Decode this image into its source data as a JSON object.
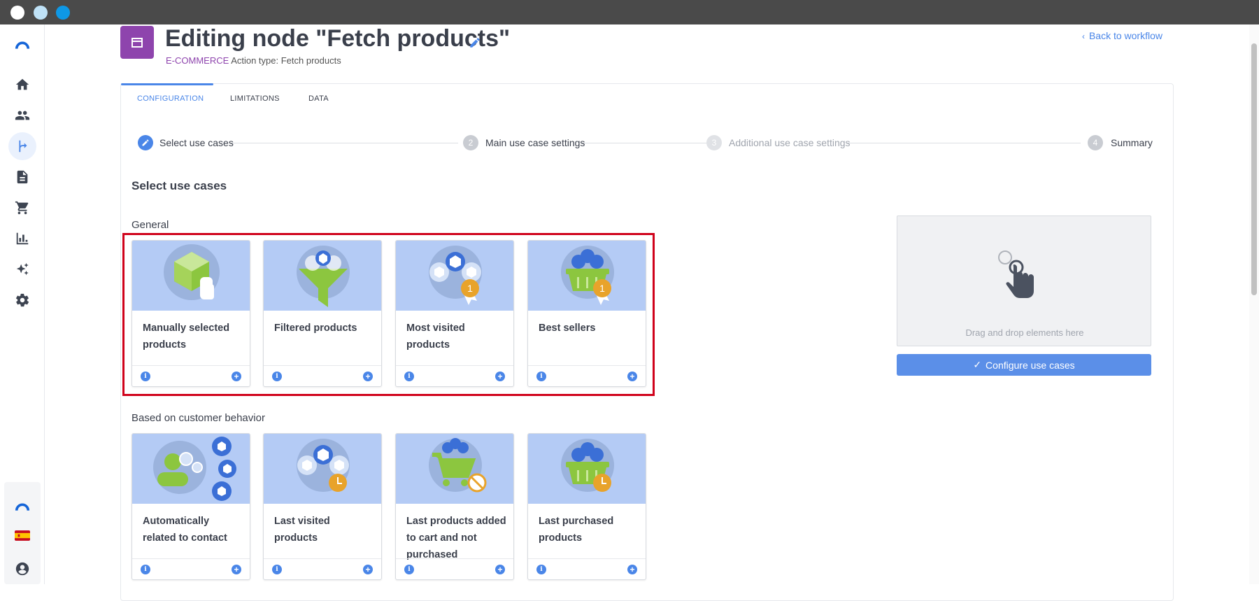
{
  "window": {
    "controls": [
      "close",
      "minimize",
      "maximize"
    ]
  },
  "sidebar": {
    "items": [
      {
        "icon": "logo-icon"
      },
      {
        "icon": "home-icon"
      },
      {
        "icon": "people-icon"
      },
      {
        "icon": "workflow-icon",
        "active": true
      },
      {
        "icon": "document-icon"
      },
      {
        "icon": "cart-icon"
      },
      {
        "icon": "bar-chart-icon"
      },
      {
        "icon": "sparkles-icon"
      },
      {
        "icon": "gear-icon"
      }
    ],
    "bottom": [
      {
        "icon": "brand-icon"
      },
      {
        "icon": "spain-flag-icon"
      },
      {
        "icon": "user-account-icon"
      }
    ]
  },
  "header": {
    "title": "Editing node \"Fetch products\"",
    "category": "E-COMMERCE",
    "action_type": "Action type: Fetch products",
    "back_link": "Back to workflow",
    "badge_color": "#8e44ad"
  },
  "tabs": [
    {
      "label": "CONFIGURATION",
      "active": true
    },
    {
      "label": "LIMITATIONS"
    },
    {
      "label": "DATA"
    }
  ],
  "steps": [
    {
      "number": "",
      "label": "Select use cases",
      "state": "active"
    },
    {
      "number": "2",
      "label": "Main use case settings",
      "state": "upcoming"
    },
    {
      "number": "3",
      "label": "Additional use case settings",
      "state": "disabled"
    },
    {
      "number": "4",
      "label": "Summary",
      "state": "upcoming"
    }
  ],
  "section_title": "Select use cases",
  "groups": [
    {
      "label": "General",
      "cards": [
        {
          "title": "Manually selected products",
          "icon": "box-hand-icon"
        },
        {
          "title": "Filtered products",
          "icon": "funnel-icon"
        },
        {
          "title": "Most visited products",
          "icon": "boxes-medal-icon"
        },
        {
          "title": "Best sellers",
          "icon": "basket-medal-icon"
        }
      ]
    },
    {
      "label": "Based on customer behavior",
      "cards": [
        {
          "title": "Automatically related to contact",
          "icon": "contact-gears-icon"
        },
        {
          "title": "Last visited products",
          "icon": "boxes-clock-icon"
        },
        {
          "title": "Last products added to cart and not purchased",
          "icon": "cart-cancel-icon"
        },
        {
          "title": "Last purchased products",
          "icon": "basket-clock-icon"
        }
      ]
    }
  ],
  "card_footer": {
    "info_glyph": "i",
    "add_glyph": "+"
  },
  "dropzone": {
    "text": "Drag and drop elements here",
    "icon": "drag-hand-icon"
  },
  "configure_button": {
    "label": "Configure use cases",
    "icon": "check-icon"
  },
  "colors": {
    "accent": "#4a86e8",
    "highlight": "#d0021b",
    "card_image_bg": "#b4cbf5",
    "green": "#8cc63f",
    "medal": "#e8a32b"
  }
}
